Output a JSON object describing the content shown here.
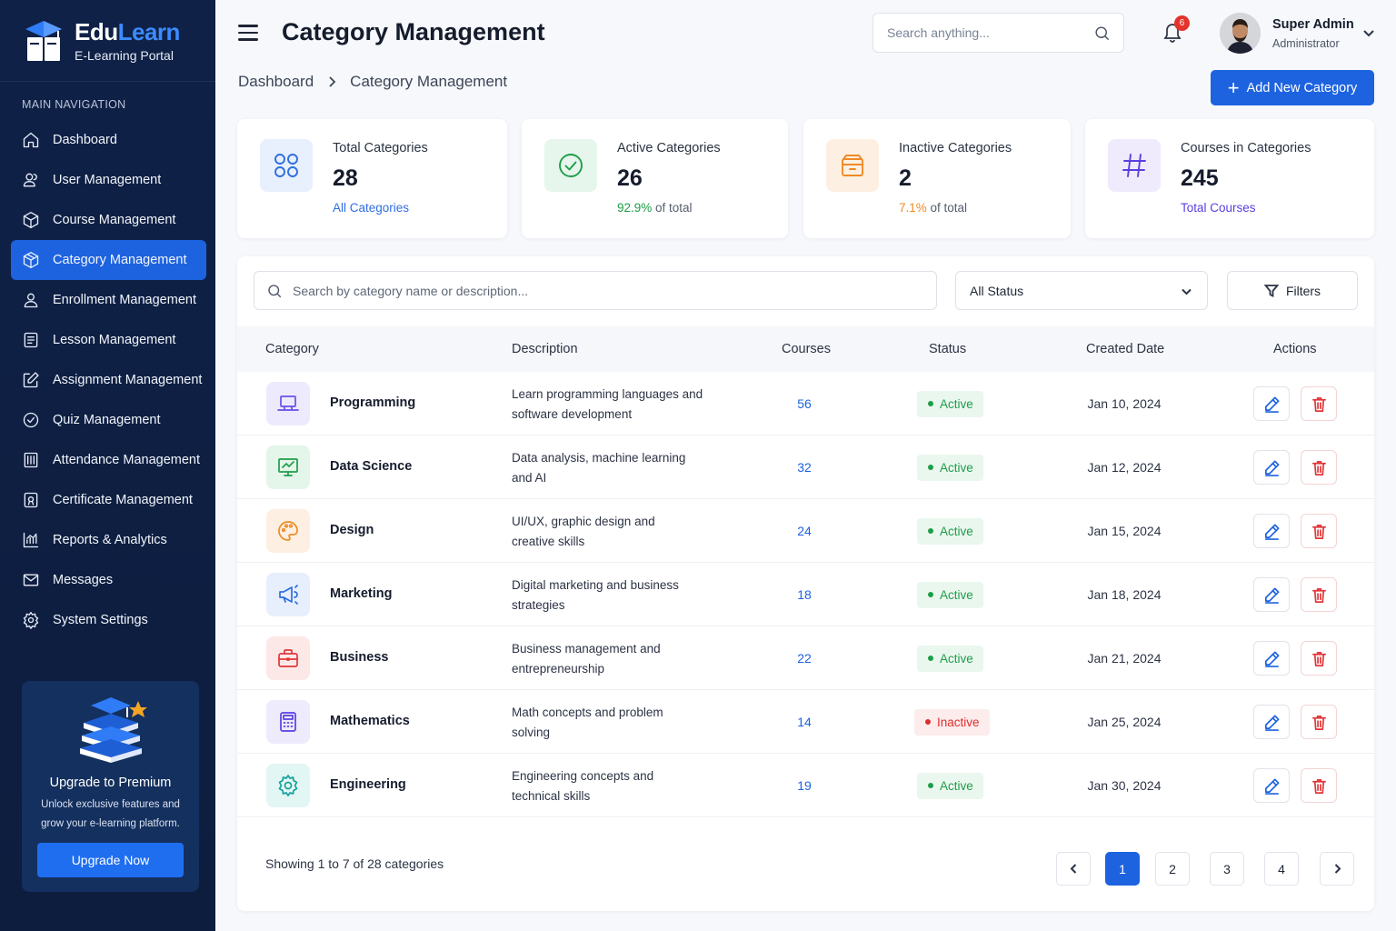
{
  "brand": {
    "name_part1": "Edu",
    "name_part2": "Learn",
    "subtitle": "E-Learning Portal"
  },
  "sidebar": {
    "heading": "MAIN NAVIGATION",
    "items": [
      {
        "label": "Dashboard",
        "icon": "home-icon"
      },
      {
        "label": "User Management",
        "icon": "users-icon"
      },
      {
        "label": "Course Management",
        "icon": "box-icon"
      },
      {
        "label": "Category Management",
        "icon": "cube-icon",
        "active": true
      },
      {
        "label": "Enrollment Management",
        "icon": "user-icon"
      },
      {
        "label": "Lesson Management",
        "icon": "document-icon"
      },
      {
        "label": "Assignment Management",
        "icon": "pen-square-icon"
      },
      {
        "label": "Quiz Management",
        "icon": "clock-check-icon"
      },
      {
        "label": "Attendance Management",
        "icon": "building-icon"
      },
      {
        "label": "Certificate Management",
        "icon": "certificate-icon"
      },
      {
        "label": "Reports & Analytics",
        "icon": "chart-icon"
      },
      {
        "label": "Messages",
        "icon": "mail-icon"
      },
      {
        "label": "System Settings",
        "icon": "gear-icon"
      }
    ],
    "upgrade": {
      "title": "Upgrade to Premium",
      "text": "Unlock exclusive features and grow your e-learning platform.",
      "button": "Upgrade Now"
    }
  },
  "header": {
    "title": "Category Management",
    "search_placeholder": "Search anything...",
    "notification_count": "6",
    "user_name": "Super Admin",
    "user_role": "Administrator"
  },
  "breadcrumb": {
    "root": "Dashboard",
    "current": "Category Management"
  },
  "add_button": "Add New Category",
  "stats": [
    {
      "label": "Total Categories",
      "value": "28",
      "sub_highlight": "All Categories",
      "sub_rest": "",
      "icon": "grid-icon",
      "accent": "#2f6ee0",
      "bg": "#e8f0fd"
    },
    {
      "label": "Active Categories",
      "value": "26",
      "sub_highlight": "92.9%",
      "sub_rest": " of total",
      "icon": "check-circle-icon",
      "accent": "#1e9d4a",
      "bg": "#e6f6ec"
    },
    {
      "label": "Inactive Categories",
      "value": "2",
      "sub_highlight": "7.1%",
      "sub_rest": " of total",
      "icon": "archive-icon",
      "accent": "#f08a24",
      "bg": "#fdf0e3"
    },
    {
      "label": "Courses in Categories",
      "value": "245",
      "sub_highlight": "Total Courses",
      "sub_rest": "",
      "icon": "hash-icon",
      "accent": "#5b3fe0",
      "bg": "#efebfd"
    }
  ],
  "table": {
    "search_placeholder": "Search by category name or description...",
    "status_filter": "All Status",
    "filters_button": "Filters",
    "columns": [
      "Category",
      "Description",
      "Courses",
      "Status",
      "Created Date",
      "Actions"
    ],
    "rows": [
      {
        "name": "Programming",
        "desc_line1": "Learn programming languages and",
        "desc_line2": "software development",
        "courses": "56",
        "status": "Active",
        "date": "Jan 10, 2024",
        "icon": "laptop-icon",
        "accent": "#6b4ee6",
        "bg": "#eeeafd"
      },
      {
        "name": "Data Science",
        "desc_line1": "Data analysis, machine learning",
        "desc_line2": "and AI",
        "courses": "32",
        "status": "Active",
        "date": "Jan 12, 2024",
        "icon": "presentation-chart-icon",
        "accent": "#1e9d4a",
        "bg": "#e4f5ea"
      },
      {
        "name": "Design",
        "desc_line1": "UI/UX, graphic design and",
        "desc_line2": "creative skills",
        "courses": "24",
        "status": "Active",
        "date": "Jan 15, 2024",
        "icon": "palette-icon",
        "accent": "#f08a24",
        "bg": "#fdefe1"
      },
      {
        "name": "Marketing",
        "desc_line1": "Digital marketing and business",
        "desc_line2": "strategies",
        "courses": "18",
        "status": "Active",
        "date": "Jan 18, 2024",
        "icon": "megaphone-icon",
        "accent": "#2f6ee0",
        "bg": "#e7effc"
      },
      {
        "name": "Business",
        "desc_line1": "Business management and",
        "desc_line2": "entrepreneurship",
        "courses": "22",
        "status": "Active",
        "date": "Jan 21, 2024",
        "icon": "briefcase-icon",
        "accent": "#e0373b",
        "bg": "#fde8e8"
      },
      {
        "name": "Mathematics",
        "desc_line1": "Math concepts and problem",
        "desc_line2": "solving",
        "courses": "14",
        "status": "Inactive",
        "date": "Jan 25, 2024",
        "icon": "calculator-icon",
        "accent": "#5b3fe0",
        "bg": "#eeebfc"
      },
      {
        "name": "Engineering",
        "desc_line1": "Engineering concepts and",
        "desc_line2": "technical skills",
        "courses": "19",
        "status": "Active",
        "date": "Jan 30, 2024",
        "icon": "gear-icon",
        "accent": "#16a39a",
        "bg": "#e2f6f4"
      }
    ],
    "showing": "Showing 1 to 7 of 28 categories",
    "pages": [
      "1",
      "2",
      "3",
      "4"
    ],
    "current_page": "1"
  }
}
